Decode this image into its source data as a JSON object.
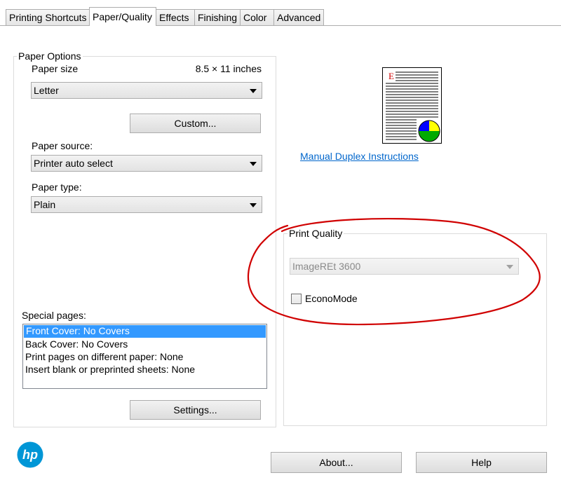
{
  "tabs": [
    {
      "label": "Printing Shortcuts",
      "active": false
    },
    {
      "label": "Paper/Quality",
      "active": true
    },
    {
      "label": "Effects",
      "active": false
    },
    {
      "label": "Finishing",
      "active": false
    },
    {
      "label": "Color",
      "active": false
    },
    {
      "label": "Advanced",
      "active": false
    }
  ],
  "paper_options": {
    "title": "Paper Options",
    "paper_size_label": "Paper size",
    "paper_size_dimensions": "8.5 × 11 inches",
    "paper_size_value": "Letter",
    "custom_button": "Custom...",
    "paper_source_label": "Paper source:",
    "paper_source_value": "Printer auto select",
    "paper_type_label": "Paper type:",
    "paper_type_value": "Plain"
  },
  "special_pages": {
    "label": "Special pages:",
    "items": [
      {
        "text": "Front Cover: No Covers",
        "selected": true
      },
      {
        "text": "Back Cover: No Covers",
        "selected": false
      },
      {
        "text": "Print pages on different paper: None",
        "selected": false
      },
      {
        "text": "Insert blank or preprinted sheets: None",
        "selected": false
      }
    ],
    "settings_button": "Settings..."
  },
  "preview": {
    "page_letter": "E",
    "accent_color": "#d00000",
    "pie_colors": [
      "#ffff00",
      "#00aa00",
      "#0000ff"
    ]
  },
  "manual_duplex_link": "Manual Duplex Instructions",
  "print_quality": {
    "title": "Print Quality",
    "resolution_value": "ImageREt 3600",
    "resolution_disabled": true,
    "economode_label": "EconoMode",
    "economode_checked": false
  },
  "footer": {
    "about_button": "About...",
    "help_button": "Help",
    "logo_text": "hp",
    "logo_color": "#0096d6"
  },
  "annotation_color": "#d00000"
}
